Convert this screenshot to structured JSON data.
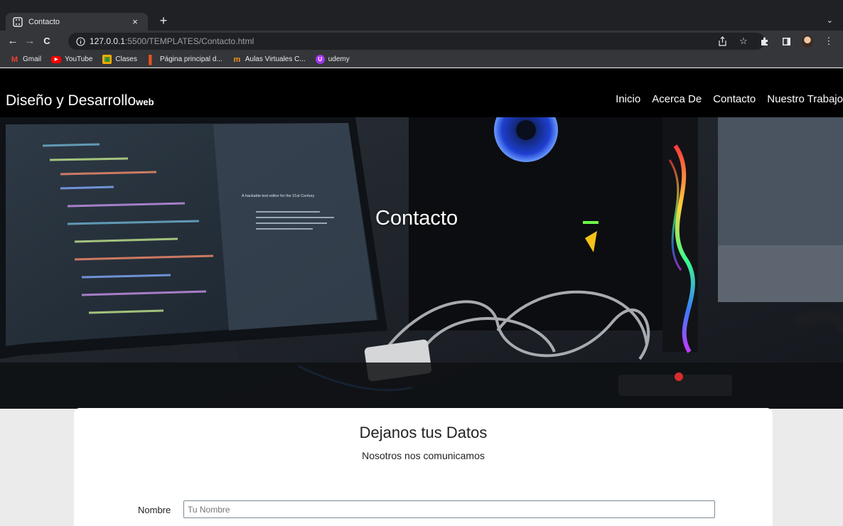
{
  "browser": {
    "tab": {
      "title": "Contacto",
      "close_glyph": "×",
      "favicon": "bracket-page-icon"
    },
    "new_tab_glyph": "+",
    "tab_search_glyph": "⌄",
    "nav": {
      "back_glyph": "←",
      "forward_glyph": "→",
      "reload_glyph": "C"
    },
    "url": {
      "host": "127.0.0.1",
      "rest": ":5500/TEMPLATES/Contacto.html"
    },
    "toolbar_icons": [
      "share-icon",
      "star-icon",
      "extensions-icon",
      "sidepanel-icon",
      "profile-avatar",
      "menu-icon"
    ],
    "bookmarks": [
      {
        "label": "Gmail",
        "icon": "gmail-icon",
        "color": "#ea4335",
        "glyph": "M"
      },
      {
        "label": "YouTube",
        "icon": "youtube-icon",
        "color": "#ff0000",
        "glyph": "▶"
      },
      {
        "label": "Clases",
        "icon": "classroom-icon",
        "color": "#f9ab00",
        "glyph": "▣"
      },
      {
        "label": "Página principal d...",
        "icon": "office-icon",
        "color": "#e8541c",
        "glyph": "▌"
      },
      {
        "label": "Aulas Virtuales C...",
        "icon": "moodle-icon",
        "color": "#f7931e",
        "glyph": "m"
      },
      {
        "label": "udemy",
        "icon": "udemy-icon",
        "color": "#a435f0",
        "glyph": "U"
      }
    ]
  },
  "site": {
    "brand": "Diseño y Desarrollo",
    "brand_suffix": "web",
    "nav": [
      "Inicio",
      "Acerca De",
      "Contacto",
      "Nuestro Trabajo"
    ]
  },
  "hero": {
    "title": "Contacto",
    "monitor_heading": "A hackable text editor for the 21st Century"
  },
  "form": {
    "title": "Dejanos tus Datos",
    "subtitle": "Nosotros nos comunicamos",
    "name_label": "Nombre",
    "name_placeholder": "Tu Nombre",
    "name_value": ""
  },
  "colors": {
    "chrome_dark": "#202124",
    "chrome_toolbar": "#35363a",
    "header_bg": "#000000",
    "page_bg": "#ebebeb"
  }
}
